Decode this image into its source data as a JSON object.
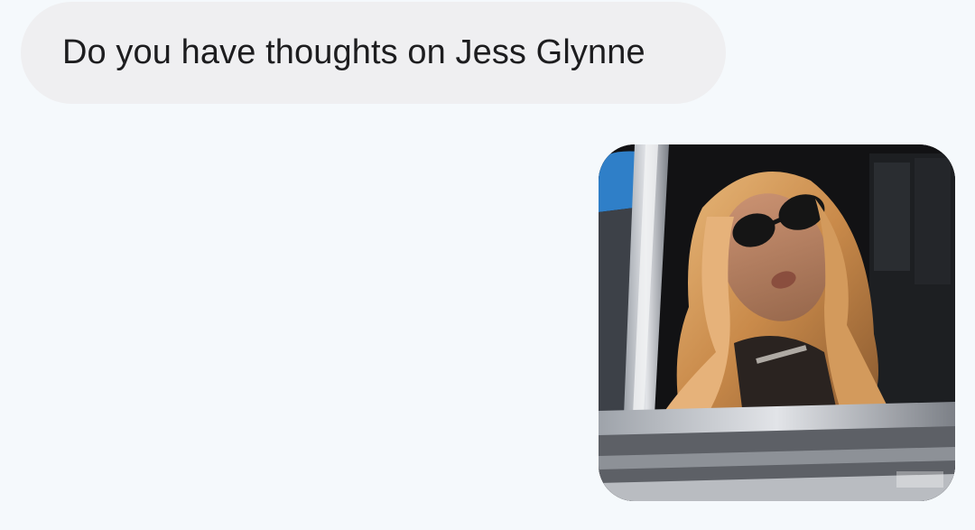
{
  "conversation": {
    "messages": [
      {
        "direction": "incoming",
        "text": "Do you have thoughts on Jess Glynne"
      },
      {
        "direction": "outgoing",
        "type": "gif",
        "media_description": "animated GIF of a woman with long blonde hair and large sunglasses looking out of a car window"
      }
    ]
  },
  "colors": {
    "background": "#f5f9fc",
    "incoming_bubble": "#efeff1",
    "incoming_text": "#1d1d1f"
  }
}
